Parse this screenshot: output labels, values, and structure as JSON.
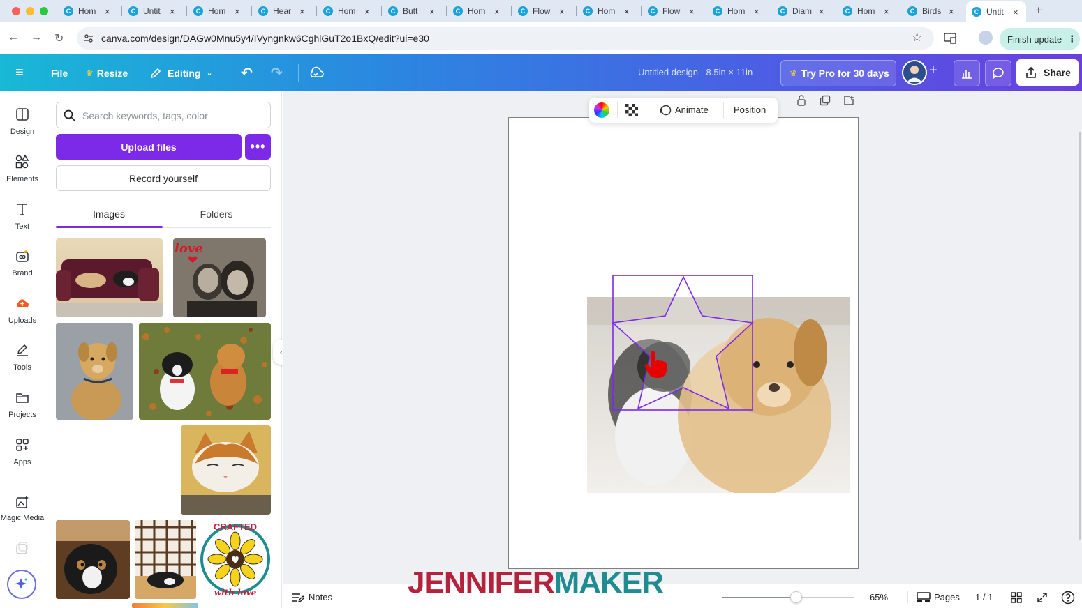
{
  "browser": {
    "tabs": [
      {
        "title": "Hom"
      },
      {
        "title": "Untit"
      },
      {
        "title": "Hom"
      },
      {
        "title": "Hear"
      },
      {
        "title": "Hom"
      },
      {
        "title": "Butt"
      },
      {
        "title": "Hom"
      },
      {
        "title": "Flow"
      },
      {
        "title": "Hom"
      },
      {
        "title": "Flow"
      },
      {
        "title": "Hom"
      },
      {
        "title": "Diam"
      },
      {
        "title": "Hom"
      },
      {
        "title": "Birds"
      },
      {
        "title": "Untit"
      }
    ],
    "new_tab": "+",
    "url": "canva.com/design/DAGw0Mnu5y4/IVyngnkw6CghlGuT2o1BxQ/edit?ui=e30",
    "finish_update": "Finish update"
  },
  "header": {
    "file": "File",
    "resize": "Resize",
    "editing": "Editing",
    "doc_title": "Untitled design - 8.5in × 11in",
    "try_pro": "Try Pro for 30 days",
    "share": "Share"
  },
  "rail": {
    "items": [
      {
        "label": "Design"
      },
      {
        "label": "Elements"
      },
      {
        "label": "Text"
      },
      {
        "label": "Brand"
      },
      {
        "label": "Uploads"
      },
      {
        "label": "Tools"
      },
      {
        "label": "Projects"
      },
      {
        "label": "Apps"
      },
      {
        "label": "Magic Media"
      }
    ]
  },
  "panel": {
    "search_placeholder": "Search keywords, tags, color",
    "upload_button": "Upload files",
    "more_button": "•••",
    "record_button": "Record yourself",
    "tabs": [
      {
        "label": "Images"
      },
      {
        "label": "Folders"
      }
    ],
    "active_tab": "Images",
    "sticker_text_top": "CRAFTED",
    "sticker_text_bottom": "with love",
    "love_text": "love"
  },
  "context_toolbar": {
    "animate": "Animate",
    "position": "Position"
  },
  "footer": {
    "notes": "Notes",
    "zoom_percent": "65%",
    "zoom_value": 0.56,
    "pages": "Pages",
    "page_counter": "1 / 1"
  },
  "watermark": {
    "part1": "JENNIFER",
    "part2": "MAKER"
  },
  "colors": {
    "canva_purple": "#7d2ae8",
    "header_start": "#19b8d6",
    "header_end": "#6a3fe0",
    "selection": "#7d2ae8",
    "cursor_hand": "#e60000"
  }
}
